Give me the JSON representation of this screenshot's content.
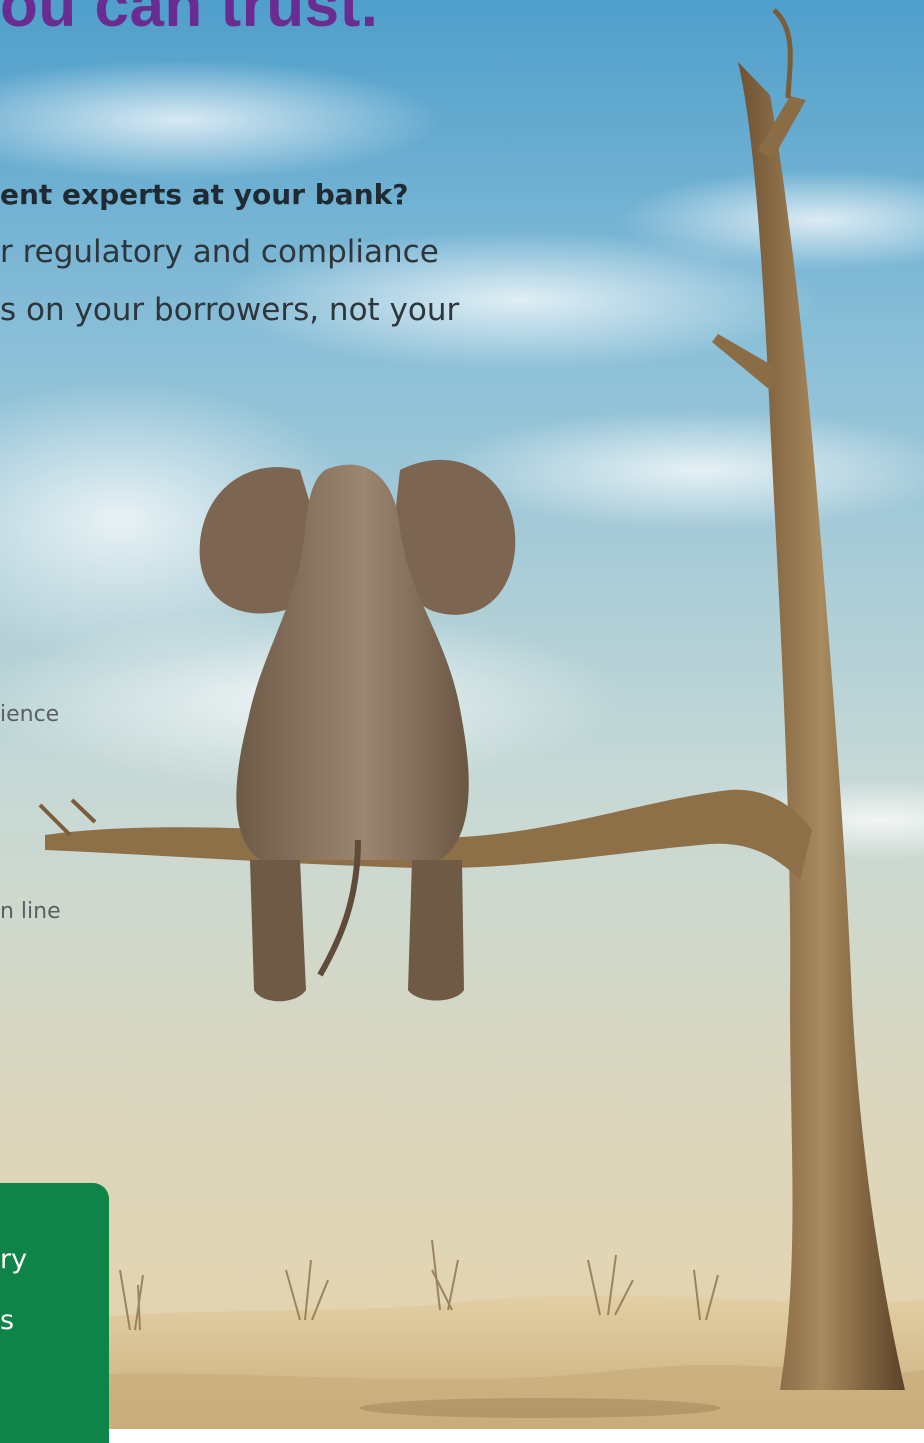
{
  "headline": "ou can trust.",
  "question": "ent experts at your bank?",
  "body_lines": [
    "r regulatory and compliance",
    "s on your borrowers, not your"
  ],
  "side_texts": [
    "ience",
    "n line"
  ],
  "cta_lines": [
    "ry",
    "s"
  ],
  "colors": {
    "headline": "#6a2c91",
    "cta_background": "#0e8448",
    "sky_top": "#4f9fcb",
    "sand": "#d8c49a"
  },
  "image": {
    "subject": "elephant sitting on tree branch in desert"
  }
}
